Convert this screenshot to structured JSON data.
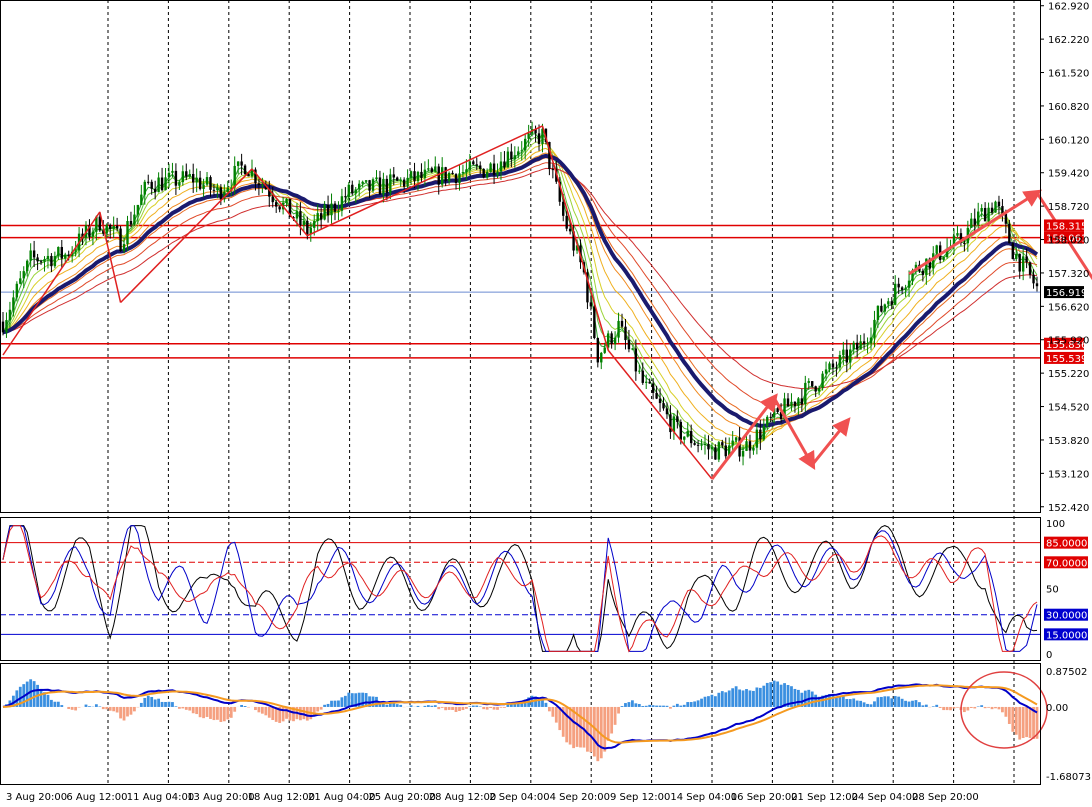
{
  "chart_data": {
    "type": "candlestick",
    "price_panel": {
      "ylim": [
        152.31,
        163.04
      ],
      "y_ticks": [
        "162.920",
        "162.220",
        "161.520",
        "160.820",
        "160.120",
        "159.420",
        "158.720",
        "158.020",
        "157.320",
        "156.620",
        "155.920",
        "155.220",
        "154.520",
        "153.820",
        "153.120",
        "152.420"
      ],
      "current_price": "156.919",
      "levels": [
        {
          "label": "158.315",
          "value": 158.315,
          "color": "#e00000"
        },
        {
          "label": "158.061",
          "value": 158.061,
          "color": "#e00000"
        },
        {
          "label": "155.836",
          "value": 155.836,
          "color": "#e00000"
        },
        {
          "label": "155.539",
          "value": 155.539,
          "color": "#e00000"
        }
      ],
      "grid": true,
      "bar_count": 300
    },
    "x_labels": [
      "3 Aug 20:00",
      "6 Aug 12:00",
      "11 Aug 04:00",
      "13 Aug 20:00",
      "18 Aug 12:00",
      "21 Aug 04:00",
      "25 Aug 20:00",
      "28 Aug 12:00",
      "2 Sep 04:00",
      "4 Sep 20:00",
      "9 Sep 12:00",
      "14 Sep 04:00",
      "16 Sep 20:00",
      "21 Sep 12:00",
      "24 Sep 04:00",
      "28 Sep 20:00"
    ],
    "stoch_panel": {
      "ylim": [
        0,
        100
      ],
      "y_ticks": [
        "100",
        "50",
        "0"
      ],
      "levels": [
        {
          "label": "85.0000",
          "value": 85,
          "color": "#e00000"
        },
        {
          "label": "70.0000",
          "value": 70,
          "color": "#e00000"
        },
        {
          "label": "30.0000",
          "value": 30,
          "color": "#0000d0"
        },
        {
          "label": "15.0000",
          "value": 15,
          "color": "#0000d0"
        }
      ]
    },
    "macd_panel": {
      "ylim": [
        -1.68073,
        0.87502
      ],
      "y_ticks": [
        "0.87502",
        "0.00",
        "-1.68073"
      ]
    }
  },
  "colors": {
    "candle_up": "#008000",
    "candle_down": "#000000",
    "ma_long": "#1a1a6e",
    "level": "#e00000",
    "arrow": "#f05050",
    "hist_pos": "#3a8fe0",
    "hist_neg": "#f5a080",
    "macd": "#0000c8",
    "signal": "#f59a20"
  }
}
